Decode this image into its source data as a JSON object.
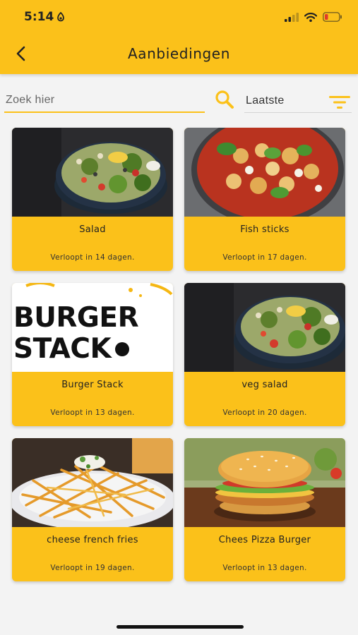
{
  "status_bar": {
    "time": "5:14"
  },
  "header": {
    "title": "Aanbiedingen"
  },
  "search": {
    "placeholder": "Zoek hier",
    "value": ""
  },
  "sort": {
    "selected": "Laatste"
  },
  "offers": [
    {
      "title": "Salad",
      "expiry": "Verloopt in 14 dagen.",
      "image": "salad-bowl"
    },
    {
      "title": "Fish sticks",
      "expiry": "Verloopt in 17 dagen.",
      "image": "baked-dish"
    },
    {
      "title": "Burger Stack",
      "expiry": "Verloopt in 13 dagen.",
      "image": "burger-stack-logo",
      "logo_text": [
        "BURGER",
        "STACK"
      ]
    },
    {
      "title": "veg salad",
      "expiry": "Verloopt in 20 dagen.",
      "image": "salad-bowl"
    },
    {
      "title": "cheese french fries",
      "expiry": "Verloopt in 19 dagen.",
      "image": "french-fries"
    },
    {
      "title": "Chees Pizza Burger",
      "expiry": "Verloopt in 13 dagen.",
      "image": "chicken-burger"
    }
  ],
  "colors": {
    "accent": "#fbc11a",
    "background": "#f3f3f3",
    "text": "#222222"
  }
}
